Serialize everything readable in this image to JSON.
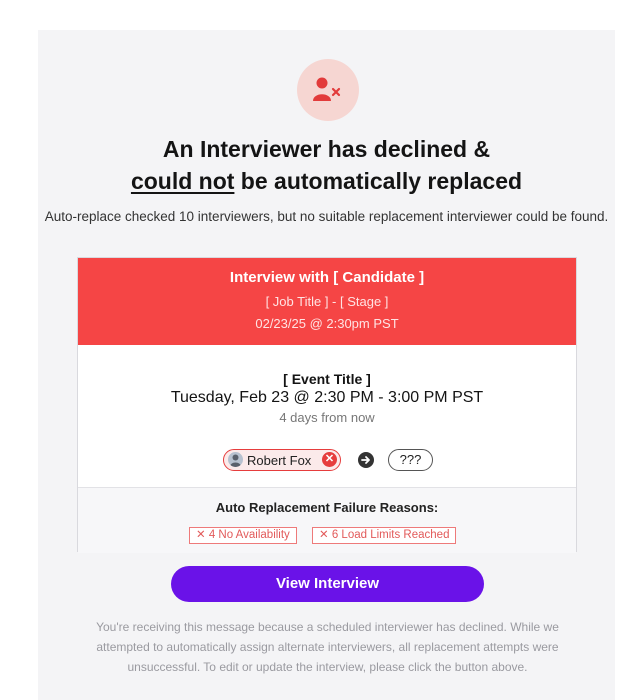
{
  "header": {
    "headline_line1": "An Interviewer has declined &",
    "headline_underlined": "could not",
    "headline_rest": " be automatically replaced",
    "subtext": "Auto-replace checked 10 interviewers, but no suitable replacement interviewer could be found."
  },
  "card": {
    "banner": {
      "title": "Interview with [ Candidate ]",
      "job_stage": "[ Job Title ] - [ Stage ]",
      "datetime": "02/23/25 @ 2:30pm PST",
      "color": "#f54545"
    },
    "event": {
      "title": "[ Event Title ]",
      "when": "Tuesday, Feb 23 @ 2:30 PM - 3:00 PM PST",
      "relative": "4 days from now"
    },
    "people": {
      "declined_interviewer": "Robert Fox",
      "replacement": "???"
    },
    "reasons": {
      "title": "Auto Replacement Failure Reasons:",
      "tags": [
        "✕ 4 No Availability",
        "✕ 6 Load Limits Reached"
      ]
    }
  },
  "cta": {
    "label": "View Interview",
    "color": "#6a12e8"
  },
  "footer": {
    "text": "You're receiving this message because a scheduled interviewer has declined. While we attempted to automatically assign alternate interviewers, all replacement attempts were unsuccessful. To edit or update the interview, please click the button above."
  },
  "icons": {
    "badge": "user-remove-icon",
    "chip_remove": "close-circle-icon",
    "flow": "arrow-right-icon"
  }
}
